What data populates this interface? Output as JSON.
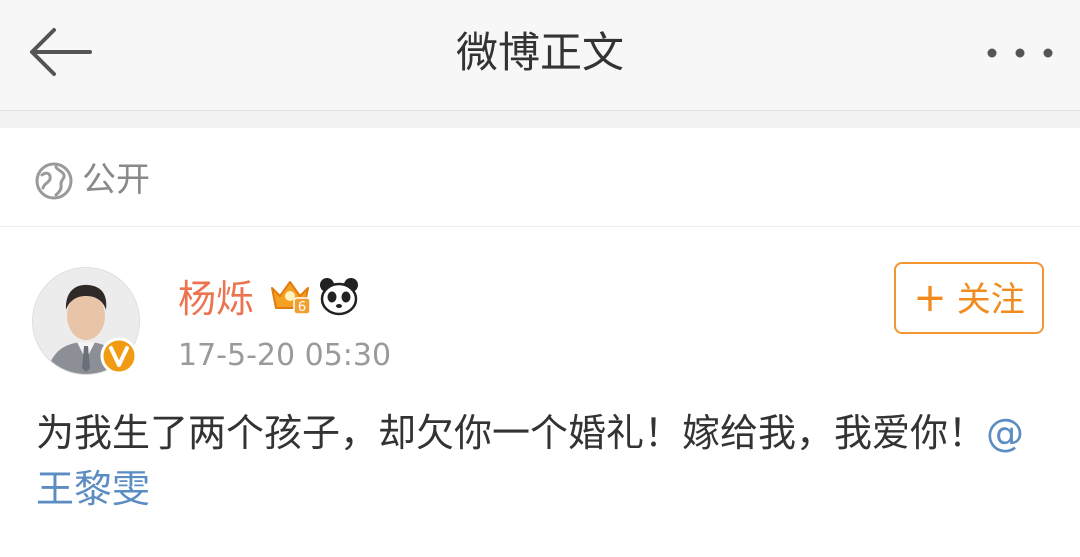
{
  "nav": {
    "back_icon": "arrow-left-icon",
    "title": "微博正文",
    "more_icon": "more-dots-icon"
  },
  "visibility": {
    "icon": "globe-icon",
    "label": "公开"
  },
  "post": {
    "author": {
      "name": "杨烁",
      "avatar_icon": "avatar",
      "verified_icon": "verified-v-icon",
      "badges": [
        "crown-icon",
        "panda-icon"
      ],
      "crown_level": "6"
    },
    "timestamp": "17-5-20 05:30",
    "follow_label": "关注",
    "text_part1": "为我生了两个孩子，却欠你一个婚礼！嫁给我，我爱你！",
    "mention": "@王黎雯"
  },
  "colors": {
    "username": "#eb7350",
    "follow": "#f28b1e",
    "mention": "#5b8cc2",
    "badge": "#f19b12"
  }
}
